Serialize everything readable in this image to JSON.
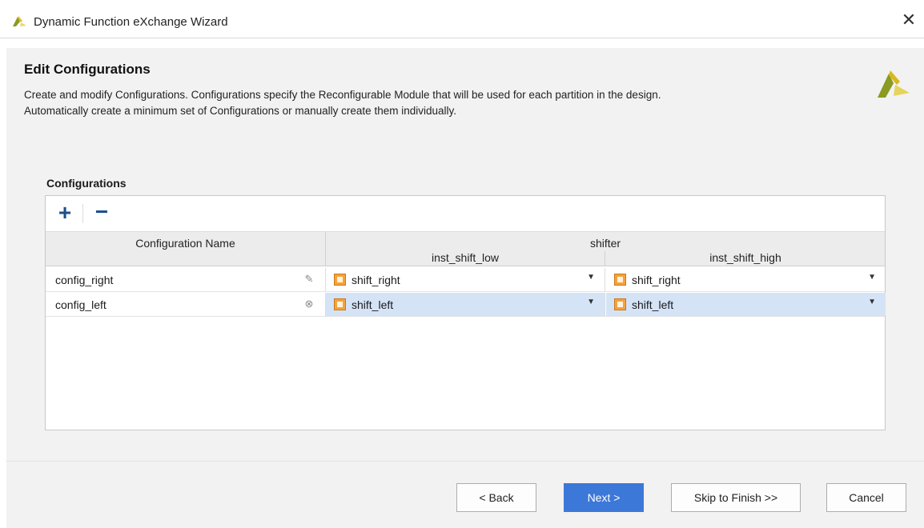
{
  "window": {
    "title": "Dynamic Function eXchange Wizard",
    "close_icon": "close-icon"
  },
  "page": {
    "title": "Edit Configurations",
    "description_line1": "Create and modify Configurations. Configurations specify the Reconfigurable Module that will be used for each partition in the design.",
    "description_line2": "Automatically create a minimum set of Configurations or manually create them individually."
  },
  "configurations": {
    "section_label": "Configurations",
    "toolbar": {
      "add_label": "+",
      "remove_label": "−"
    },
    "columns": {
      "config_name": "Configuration Name",
      "group": "shifter",
      "sub1": "inst_shift_low",
      "sub2": "inst_shift_high"
    },
    "rows": [
      {
        "name": "config_right",
        "low": "shift_right",
        "high": "shift_right",
        "row_icon": "edit-pencil-icon"
      },
      {
        "name": "config_left",
        "low": "shift_left",
        "high": "shift_left",
        "row_icon": "clear-icon"
      }
    ]
  },
  "footer": {
    "back_label": "< Back",
    "next_label": "Next >",
    "skip_label": "Skip to Finish >>",
    "cancel_label": "Cancel"
  },
  "colors": {
    "accent": "#3c78d8",
    "selection": "#d5e3f7",
    "module_icon": "#f6a23b"
  }
}
